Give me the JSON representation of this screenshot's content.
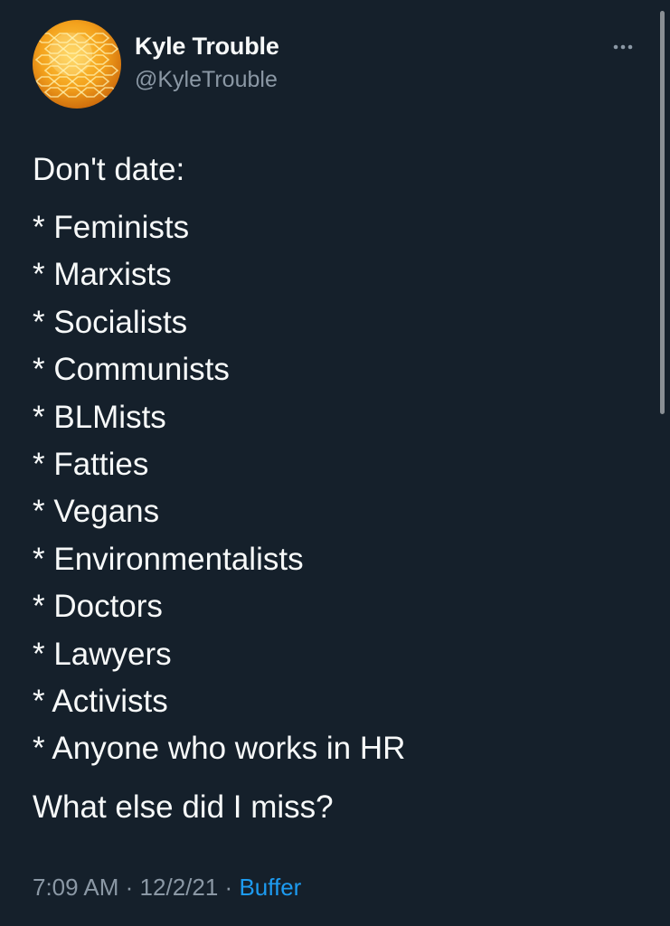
{
  "author": {
    "display_name": "Kyle Trouble",
    "handle": "@KyleTrouble",
    "avatar_icon": "honeycomb-avatar"
  },
  "menu": {
    "icon": "more-options-icon"
  },
  "tweet": {
    "intro": "Don't date:",
    "items": [
      "* Feminists",
      "* Marxists",
      "* Socialists",
      "* Communists",
      "* BLMists",
      "* Fatties",
      "* Vegans",
      "* Environmentalists",
      "* Doctors",
      "* Lawyers",
      "* Activists",
      "* Anyone who works in HR"
    ],
    "outro": "What else did I miss?"
  },
  "meta": {
    "time": "7:09 AM",
    "date": "12/2/21",
    "separator": "·",
    "source": "Buffer"
  },
  "colors": {
    "background": "#15202b",
    "text": "#f7f9f9",
    "secondary": "#8b98a5",
    "accent": "#1d9bf0"
  }
}
